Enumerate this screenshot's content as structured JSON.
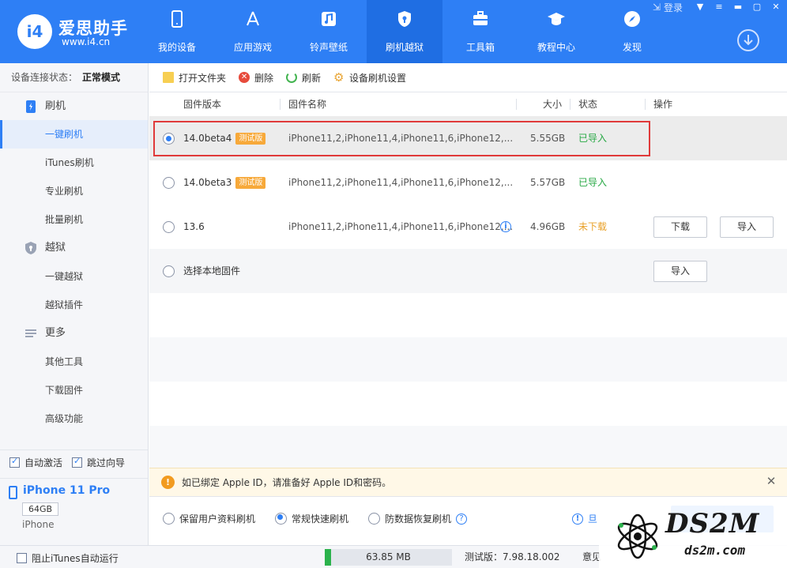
{
  "app": {
    "logo_badge": "i4",
    "logo_title": "爱思助手",
    "logo_url": "www.i4.cn",
    "brand_color": "#2e7ff5"
  },
  "window": {
    "login": "登录",
    "buttons": [
      "shirt-icon",
      "menu-icon",
      "minimize-icon",
      "maximize-icon",
      "close-icon"
    ]
  },
  "nav": [
    {
      "label": "我的设备",
      "icon": "phone-icon"
    },
    {
      "label": "应用游戏",
      "icon": "app-store-icon"
    },
    {
      "label": "铃声壁纸",
      "icon": "music-icon"
    },
    {
      "label": "刷机越狱",
      "icon": "lock-shield-icon",
      "active": true
    },
    {
      "label": "工具箱",
      "icon": "toolbox-icon"
    },
    {
      "label": "教程中心",
      "icon": "graduation-cap-icon"
    },
    {
      "label": "发现",
      "icon": "compass-icon"
    }
  ],
  "sidebar": {
    "status_label": "设备连接状态：",
    "status_value": "正常模式",
    "groups": [
      {
        "label": "刷机",
        "icon": "flash-icon",
        "items": [
          "一键刷机",
          "iTunes刷机",
          "专业刷机",
          "批量刷机"
        ]
      },
      {
        "label": "越狱",
        "icon": "shield-icon",
        "items": [
          "一键越狱",
          "越狱插件"
        ]
      },
      {
        "label": "更多",
        "icon": "list-icon",
        "items": [
          "其他工具",
          "下载固件",
          "高级功能"
        ]
      }
    ],
    "active_item": "一键刷机",
    "checks": [
      {
        "label": "自动激活",
        "checked": true
      },
      {
        "label": "跳过向导",
        "checked": true
      }
    ]
  },
  "device": {
    "name": "iPhone 11 Pro",
    "capacity": "64GB",
    "model": "iPhone"
  },
  "toolbar": {
    "open_folder": "打开文件夹",
    "delete": "删除",
    "refresh": "刷新",
    "settings": "设备刷机设置"
  },
  "table": {
    "headers": {
      "version": "固件版本",
      "name": "固件名称",
      "size": "大小",
      "status": "状态",
      "action": "操作"
    },
    "rows": [
      {
        "version": "14.0beta4",
        "badge": "测试版",
        "name": "iPhone11,2,iPhone11,4,iPhone11,6,iPhone12,...",
        "size": "5.55GB",
        "status": "已导入",
        "selected": true
      },
      {
        "version": "14.0beta3",
        "badge": "测试版",
        "name": "iPhone11,2,iPhone11,4,iPhone11,6,iPhone12,...",
        "size": "5.57GB",
        "status": "已导入",
        "selected": false
      },
      {
        "version": "13.6",
        "badge": "",
        "name": "iPhone11,2,iPhone11,4,iPhone11,6,iPhone12,...",
        "size": "4.96GB",
        "status": "未下载",
        "selected": false,
        "download": "下载",
        "import": "导入"
      },
      {
        "version": "选择本地固件",
        "import": "导入",
        "selected": false
      }
    ],
    "status_colors": {
      "imported": "#27a844",
      "not_downloaded": "#e9a027"
    }
  },
  "alert": {
    "text": "如已绑定 Apple ID，请准备好 Apple ID和密码。"
  },
  "modes": {
    "options": [
      "保留用户资料刷机",
      "常规快速刷机",
      "防数据恢复刷机"
    ],
    "selected": "常规快速刷机",
    "warn_text": "旦"
  },
  "statusbar": {
    "block_itunes": "阻止iTunes自动运行",
    "memory": "63.85 MB",
    "memory_fraction": 0.05,
    "version": "测试版：7.98.18.002",
    "feedback": "意见"
  },
  "watermark": {
    "text": "DS2M",
    "sub": "ds2m.com"
  }
}
